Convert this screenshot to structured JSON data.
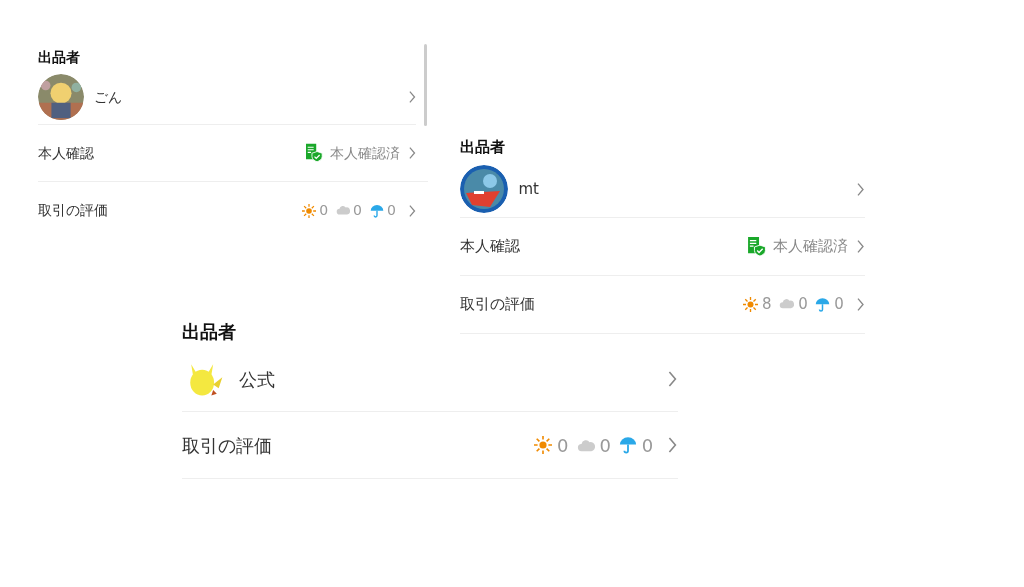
{
  "panels": [
    {
      "heading": "出品者",
      "seller": {
        "name": "ごん"
      },
      "rows": [
        {
          "kind": "verification",
          "label": "本人確認",
          "value": "本人確認済"
        },
        {
          "kind": "rating",
          "label": "取引の評価",
          "counts": [
            {
              "kind": "sun",
              "value": "0"
            },
            {
              "kind": "cloud",
              "value": "0"
            },
            {
              "kind": "umbrella",
              "value": "0"
            }
          ]
        }
      ]
    },
    {
      "heading": "出品者",
      "seller": {
        "name": "mt"
      },
      "rows": [
        {
          "kind": "verification",
          "label": "本人確認",
          "value": "本人確認済"
        },
        {
          "kind": "rating",
          "label": "取引の評価",
          "counts": [
            {
              "kind": "sun",
              "value": "8"
            },
            {
              "kind": "cloud",
              "value": "0"
            },
            {
              "kind": "umbrella",
              "value": "0"
            }
          ]
        }
      ]
    },
    {
      "heading": "出品者",
      "seller": {
        "name": "公式"
      },
      "rows": [
        {
          "kind": "rating",
          "label": "取引の評価",
          "counts": [
            {
              "kind": "sun",
              "value": "0"
            },
            {
              "kind": "cloud",
              "value": "0"
            },
            {
              "kind": "umbrella",
              "value": "0"
            }
          ]
        }
      ]
    }
  ]
}
